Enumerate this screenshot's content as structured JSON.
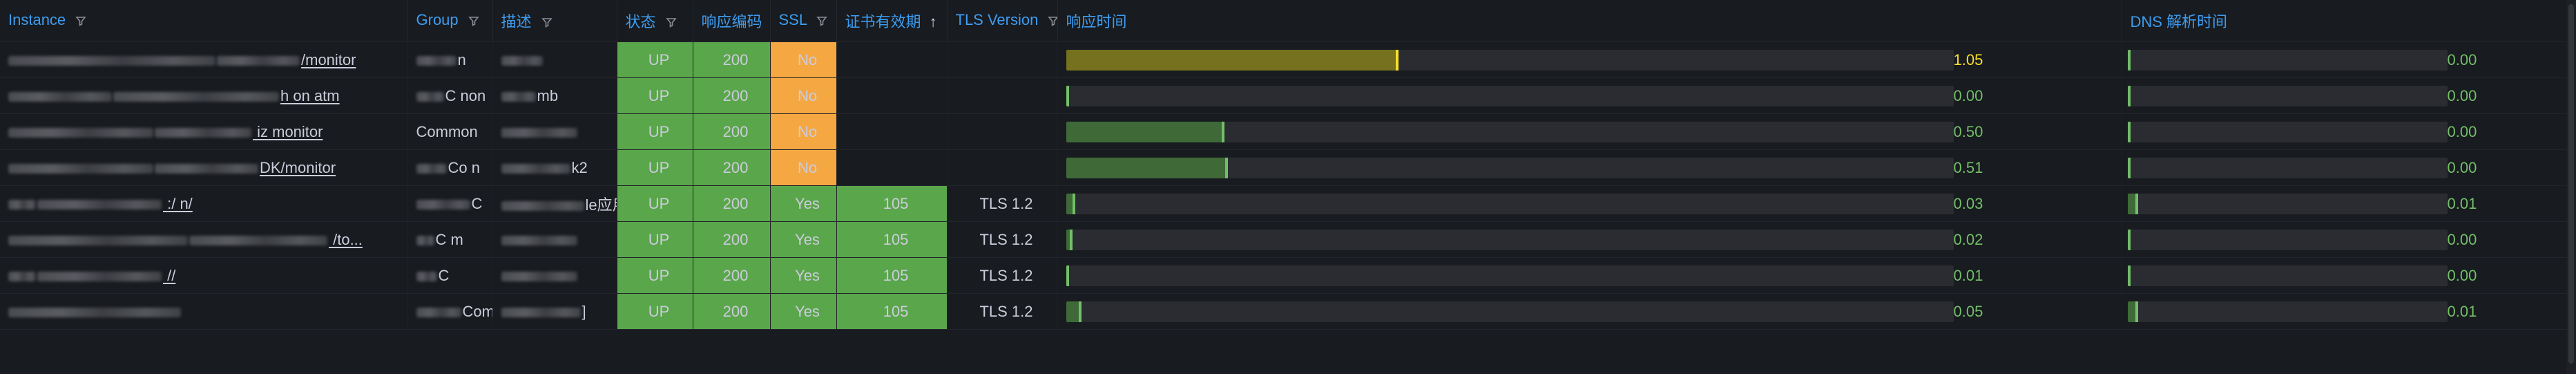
{
  "table": {
    "columns": {
      "instance": "Instance",
      "group": "Group",
      "desc": "描述",
      "status": "状态",
      "code": "响应编码",
      "ssl": "SSL",
      "cert": "证书有效期",
      "tls": "TLS Version",
      "response": "响应时间",
      "dns": "DNS 解析时间"
    },
    "sort_indicator": "↑",
    "colors": {
      "header_text": "#3d9df2",
      "ok_bg": "#5aa64b",
      "warn_bg": "#f5a742",
      "value_green": "#73bf69",
      "value_yellow": "#fade2a",
      "gauge_track": "#2a2c32"
    },
    "gauge_max": 2.8,
    "dns_gauge_max": 0.3,
    "rows": [
      {
        "instance": "/monitor",
        "group": "n",
        "desc": "",
        "status": "UP",
        "code": "200",
        "ssl": "No",
        "cert": "",
        "tls": "",
        "response": "1.05",
        "response_value": 1.05,
        "dns": "0.00",
        "dns_value": 0.0
      },
      {
        "instance": "h                    on                  atm",
        "group": "C      non",
        "desc": "mb",
        "status": "UP",
        "code": "200",
        "ssl": "No",
        "cert": "",
        "tls": "",
        "response": "0.00",
        "response_value": 0.0,
        "dns": "0.00",
        "dns_value": 0.0
      },
      {
        "instance": "             iz      monitor",
        "group": "Common",
        "desc": "",
        "status": "UP",
        "code": "200",
        "ssl": "No",
        "cert": "",
        "tls": "",
        "response": "0.50",
        "response_value": 0.5,
        "dns": "0.00",
        "dns_value": 0.0
      },
      {
        "instance": "DK/monitor",
        "group": "Co      n",
        "desc": "k2",
        "status": "UP",
        "code": "200",
        "ssl": "No",
        "cert": "",
        "tls": "",
        "response": "0.51",
        "response_value": 0.51,
        "dns": "0.00",
        "dns_value": 0.0
      },
      {
        "instance": "       :/                      n/",
        "group": "C",
        "desc": "le应用",
        "status": "UP",
        "code": "200",
        "ssl": "Yes",
        "cert": "105",
        "tls": "TLS 1.2",
        "response": "0.03",
        "response_value": 0.03,
        "dns": "0.01",
        "dns_value": 0.01
      },
      {
        "instance": "                                 /to...",
        "group": "C      m",
        "desc": "",
        "status": "UP",
        "code": "200",
        "ssl": "Yes",
        "cert": "105",
        "tls": "TLS 1.2",
        "response": "0.02",
        "response_value": 0.02,
        "dns": "0.00",
        "dns_value": 0.0
      },
      {
        "instance": "       //",
        "group": "C",
        "desc": "",
        "status": "UP",
        "code": "200",
        "ssl": "Yes",
        "cert": "105",
        "tls": "TLS 1.2",
        "response": "0.01",
        "response_value": 0.01,
        "dns": "0.00",
        "dns_value": 0.0
      },
      {
        "instance": "",
        "group": "Com",
        "desc": "]",
        "status": "UP",
        "code": "200",
        "ssl": "Yes",
        "cert": "105",
        "tls": "TLS 1.2",
        "response": "0.05",
        "response_value": 0.05,
        "dns": "0.01",
        "dns_value": 0.01
      }
    ]
  }
}
